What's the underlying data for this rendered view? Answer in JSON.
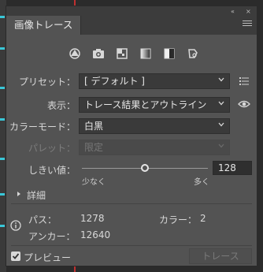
{
  "panel": {
    "tab_title": "画像トレース",
    "collapse_glyph": "«",
    "close_glyph": "×",
    "icons": [
      "auto-color-icon",
      "high-color-icon",
      "low-color-icon",
      "grayscale-icon",
      "black-white-icon",
      "outline-icon"
    ]
  },
  "preset": {
    "label": "プリセット：",
    "value": "[ デフォルト ]"
  },
  "view": {
    "label": "表示：",
    "value": "トレース結果とアウトライン"
  },
  "mode": {
    "label": "カラーモード：",
    "value": "白黒"
  },
  "palette": {
    "label": "パレット：",
    "value": "限定",
    "disabled": true
  },
  "threshold": {
    "label": "しきい値：",
    "min_label": "少なく",
    "max_label": "多く",
    "value": "128",
    "max": 255
  },
  "advanced": {
    "label": "詳細"
  },
  "info": {
    "paths_label": "パス：",
    "paths_value": "1278",
    "colors_label": "カラー：",
    "colors_value": "2",
    "anchors_label": "アンカー：",
    "anchors_value": "12640"
  },
  "footer": {
    "preview_label": "プレビュー",
    "preview_checked": true,
    "trace_label": "トレース",
    "trace_enabled": false
  },
  "colors": {
    "panel_bg": "#535353",
    "field_bg": "#3a3a3a",
    "canvas_accent": "#39c7d8",
    "guide_red": "#c03030"
  }
}
